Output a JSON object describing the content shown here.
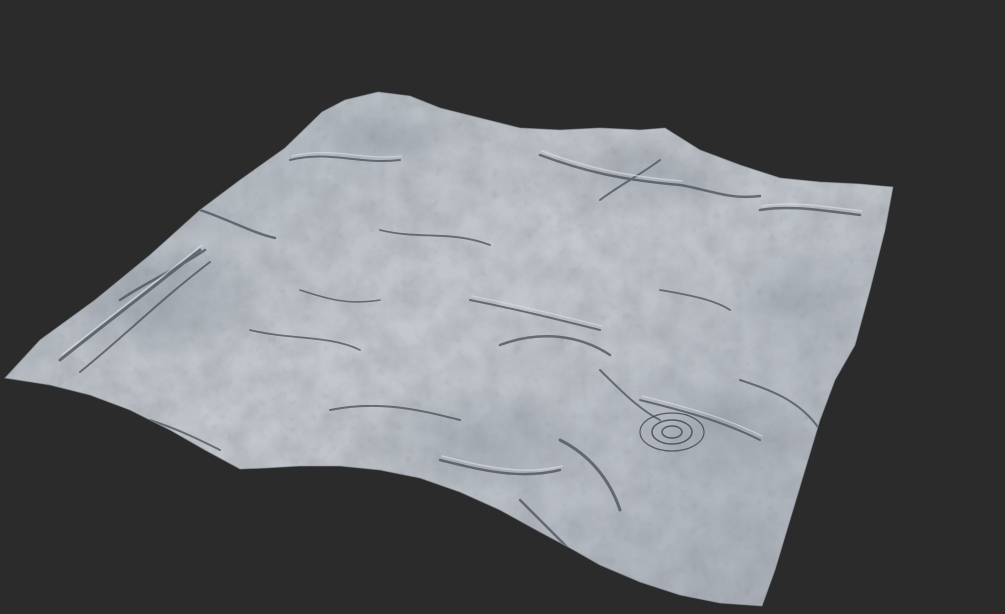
{
  "viewport": {
    "background_color": "#2b2b2b",
    "content": "terrain-heightmap-render"
  },
  "terrain": {
    "base_color": "#b9bec5",
    "highlight_color": "#d4d8dd",
    "shadow_color": "#4a4f57",
    "deep_shadow_color": "#2f333a"
  }
}
